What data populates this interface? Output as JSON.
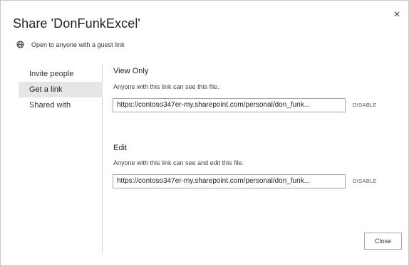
{
  "dialog": {
    "title": "Share 'DonFunkExcel'",
    "close_glyph": "×"
  },
  "guest": {
    "icon": "globe-icon",
    "text": "Open to anyone with a guest link"
  },
  "sidebar": {
    "items": [
      {
        "label": "Invite people",
        "active": false
      },
      {
        "label": "Get a link",
        "active": true
      },
      {
        "label": "Shared with",
        "active": false
      }
    ]
  },
  "view_only": {
    "title": "View Only",
    "description": "Anyone with this link can see this file.",
    "link": "https://contoso347er-my.sharepoint.com/personal/don_funk...",
    "disable_label": "DISABLE"
  },
  "edit": {
    "title": "Edit",
    "description": "Anyone with this link can see and edit this file.",
    "link": "https://contoso347er-my.sharepoint.com/personal/don_funk...",
    "disable_label": "DISABLE"
  },
  "footer": {
    "close_label": "Close"
  }
}
